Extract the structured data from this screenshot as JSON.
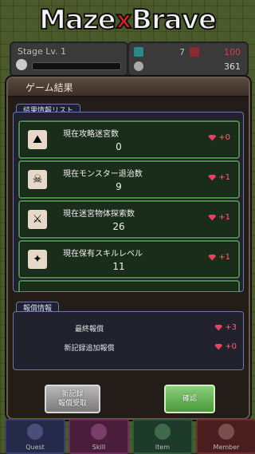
{
  "logo": {
    "maze": "Maze",
    "x": "x",
    "brave": "Brave"
  },
  "stage": {
    "label": "Stage Lv. 1"
  },
  "stats": {
    "gems": "7",
    "skulls": "361",
    "hp": "100"
  },
  "dialog": {
    "title": "ゲーム結果",
    "section_list": "結果情報リスト",
    "items": [
      {
        "icon": "dungeon-icon",
        "label": "現在攻略迷宮数",
        "value": "0",
        "reward": "+0"
      },
      {
        "icon": "skull-icon",
        "label": "現在モンスター退治数",
        "value": "9",
        "reward": "+1"
      },
      {
        "icon": "item-icon",
        "label": "現在迷宮物体探索数",
        "value": "26",
        "reward": "+1"
      },
      {
        "icon": "skill-icon",
        "label": "現在保有スキルレベル",
        "value": "11",
        "reward": "+1"
      }
    ],
    "section_reward": "報償情報",
    "rewards": [
      {
        "label": "最終報償",
        "value": "+3"
      },
      {
        "label": "新記録追加報償",
        "value": "+0"
      }
    ],
    "btn_record_1": "新記録",
    "btn_record_2": "報償受取",
    "btn_ok": "確認"
  },
  "nav": [
    {
      "label": "Quest",
      "icon": "quest-icon"
    },
    {
      "label": "Skill",
      "icon": "skill-icon"
    },
    {
      "label": "Item",
      "icon": "item-icon"
    },
    {
      "label": "Member",
      "icon": "member-icon"
    }
  ],
  "colors": {
    "gem": "#e84060",
    "accent_green": "#4a8a4a",
    "brand_red": "#e02020"
  }
}
